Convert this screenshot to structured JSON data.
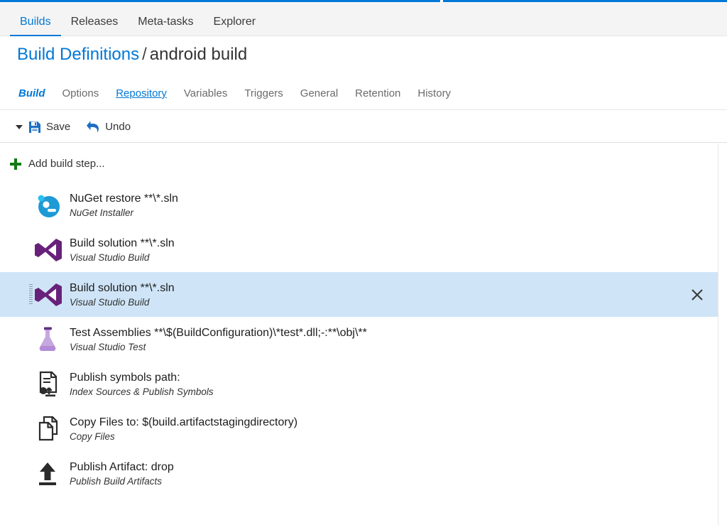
{
  "theme": {
    "accent": "#0078d7",
    "selected_row_bg": "#cfe5f7",
    "plus_green": "#107c10"
  },
  "hub_nav": {
    "tabs": [
      {
        "label": "Builds",
        "selected": true
      },
      {
        "label": "Releases",
        "selected": false
      },
      {
        "label": "Meta-tasks",
        "selected": false
      },
      {
        "label": "Explorer",
        "selected": false
      }
    ]
  },
  "breadcrumb": {
    "root": "Build Definitions",
    "separator": "/",
    "current": "android build"
  },
  "pivots": {
    "items": [
      {
        "label": "Build",
        "state": "selected"
      },
      {
        "label": "Options",
        "state": "normal"
      },
      {
        "label": "Repository",
        "state": "hovered"
      },
      {
        "label": "Variables",
        "state": "normal"
      },
      {
        "label": "Triggers",
        "state": "normal"
      },
      {
        "label": "General",
        "state": "normal"
      },
      {
        "label": "Retention",
        "state": "normal"
      },
      {
        "label": "History",
        "state": "normal"
      }
    ]
  },
  "toolbar": {
    "save_label": "Save",
    "undo_label": "Undo"
  },
  "content": {
    "add_step_label": "Add build step...",
    "steps": [
      {
        "title": "NuGet restore **\\*.sln",
        "subtitle": "NuGet Installer",
        "icon": "nuget-icon",
        "selected": false
      },
      {
        "title": "Build solution **\\*.sln",
        "subtitle": "Visual Studio Build",
        "icon": "visual-studio-icon",
        "selected": false
      },
      {
        "title": "Build solution **\\*.sln",
        "subtitle": "Visual Studio Build",
        "icon": "visual-studio-icon",
        "selected": true
      },
      {
        "title": "Test Assemblies **\\$(BuildConfiguration)\\*test*.dll;-:**\\obj\\**",
        "subtitle": "Visual Studio Test",
        "icon": "test-flask-icon",
        "selected": false
      },
      {
        "title": "Publish symbols path:",
        "subtitle": "Index Sources & Publish Symbols",
        "icon": "publish-symbols-icon",
        "selected": false
      },
      {
        "title": "Copy Files to: $(build.artifactstagingdirectory)",
        "subtitle": "Copy Files",
        "icon": "copy-files-icon",
        "selected": false
      },
      {
        "title": "Publish Artifact: drop",
        "subtitle": "Publish Build Artifacts",
        "icon": "publish-artifact-icon",
        "selected": false
      }
    ]
  }
}
